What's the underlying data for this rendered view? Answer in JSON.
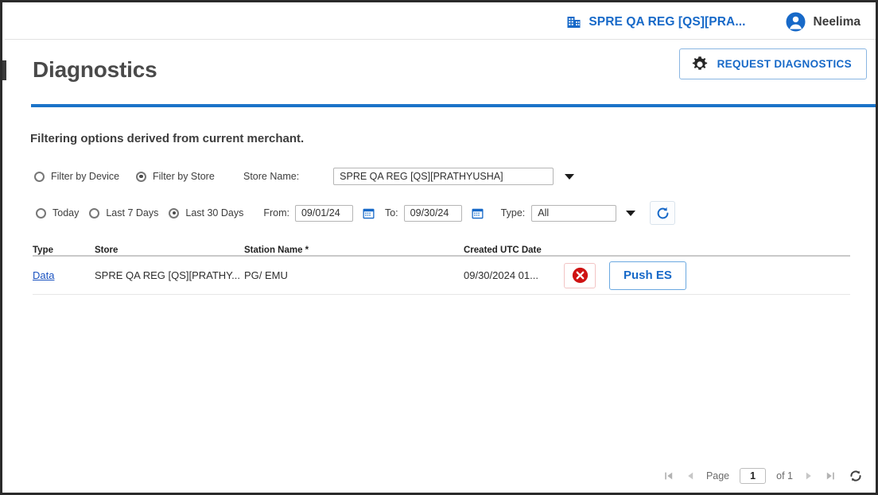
{
  "topbar": {
    "merchant_label": "SPRE QA REG [QS][PRA...",
    "merchant_icon": "building-icon",
    "user_name": "Neelima",
    "user_icon": "user-avatar-icon"
  },
  "header": {
    "title": "Diagnostics",
    "request_button_label": "REQUEST DIAGNOSTICS",
    "request_button_icon": "gear-icon",
    "accent_color": "#1a73c8"
  },
  "filters": {
    "note": "Filtering options derived from current merchant.",
    "scope_options": [
      {
        "label": "Filter by Device",
        "selected": false
      },
      {
        "label": "Filter by Store",
        "selected": true
      }
    ],
    "store_name_label": "Store Name:",
    "store_name_value": "SPRE QA REG [QS][PRATHYUSHA]",
    "range_options": [
      {
        "label": "Today",
        "selected": false
      },
      {
        "label": "Last 7 Days",
        "selected": false
      },
      {
        "label": "Last 30 Days",
        "selected": true
      }
    ],
    "from_label": "From:",
    "from_value": "09/01/24",
    "to_label": "To:",
    "to_value": "09/30/24",
    "type_label": "Type:",
    "type_value": "All",
    "calendar_icon": "calendar-icon",
    "refresh_icon": "refresh-icon"
  },
  "table": {
    "columns": [
      "Type",
      "Store",
      "Station Name *",
      "Created UTC Date"
    ],
    "rows": [
      {
        "type": "Data",
        "store": "SPRE QA REG [QS][PRATHY...",
        "station": "PG/ EMU",
        "created": "09/30/2024 01...",
        "delete_icon": "delete-circle-icon",
        "action_label": "Push ES"
      }
    ]
  },
  "pager": {
    "first_icon": "first-page-icon",
    "prev_icon": "prev-page-icon",
    "page_label": "Page",
    "page_value": "1",
    "of_label": "of 1",
    "next_icon": "next-page-icon",
    "last_icon": "last-page-icon",
    "refresh_icon": "refresh-circle-icon"
  }
}
